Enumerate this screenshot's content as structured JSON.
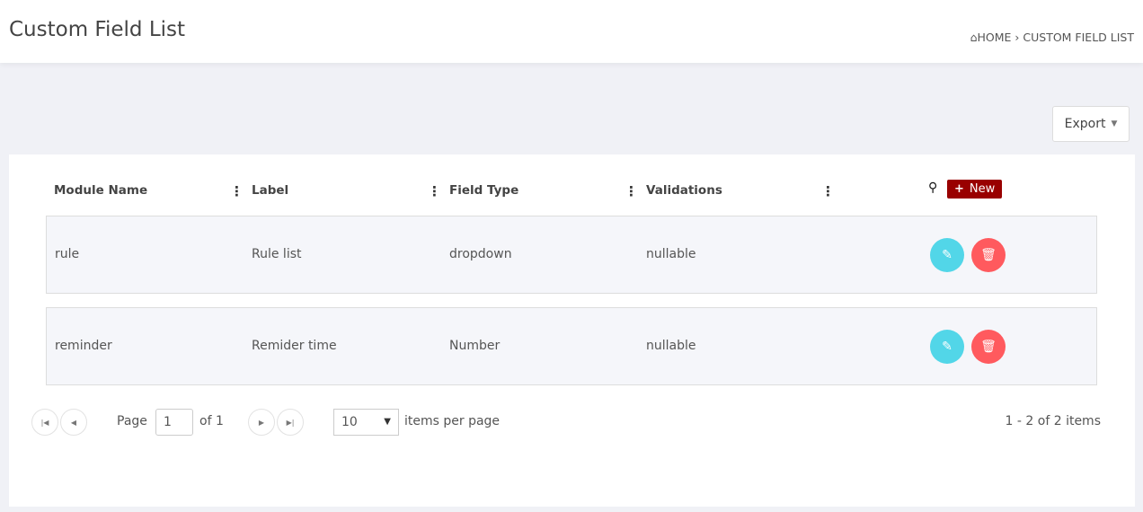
{
  "header": {
    "title": "Custom Field List",
    "breadcrumb": {
      "home": "HOME",
      "separator": "›",
      "current": "CUSTOM FIELD LIST"
    }
  },
  "toolbar": {
    "export_label": "Export"
  },
  "table": {
    "columns": [
      "Module Name",
      "Label",
      "Field Type",
      "Validations"
    ],
    "new_label": "New",
    "rows": [
      {
        "module": "rule",
        "label": "Rule list",
        "type": "dropdown",
        "validations": "nullable"
      },
      {
        "module": "reminder",
        "label": "Remider time",
        "type": "Number",
        "validations": "nullable"
      }
    ]
  },
  "pagination": {
    "page_label": "Page",
    "page": "1",
    "of_label": "of 1",
    "page_size": "10",
    "per_page_label": "items per page",
    "summary": "1 - 2 of 2 items"
  },
  "colors": {
    "new": "#990000",
    "edit": "#52d6e8",
    "delete": "#ff5a5e"
  }
}
